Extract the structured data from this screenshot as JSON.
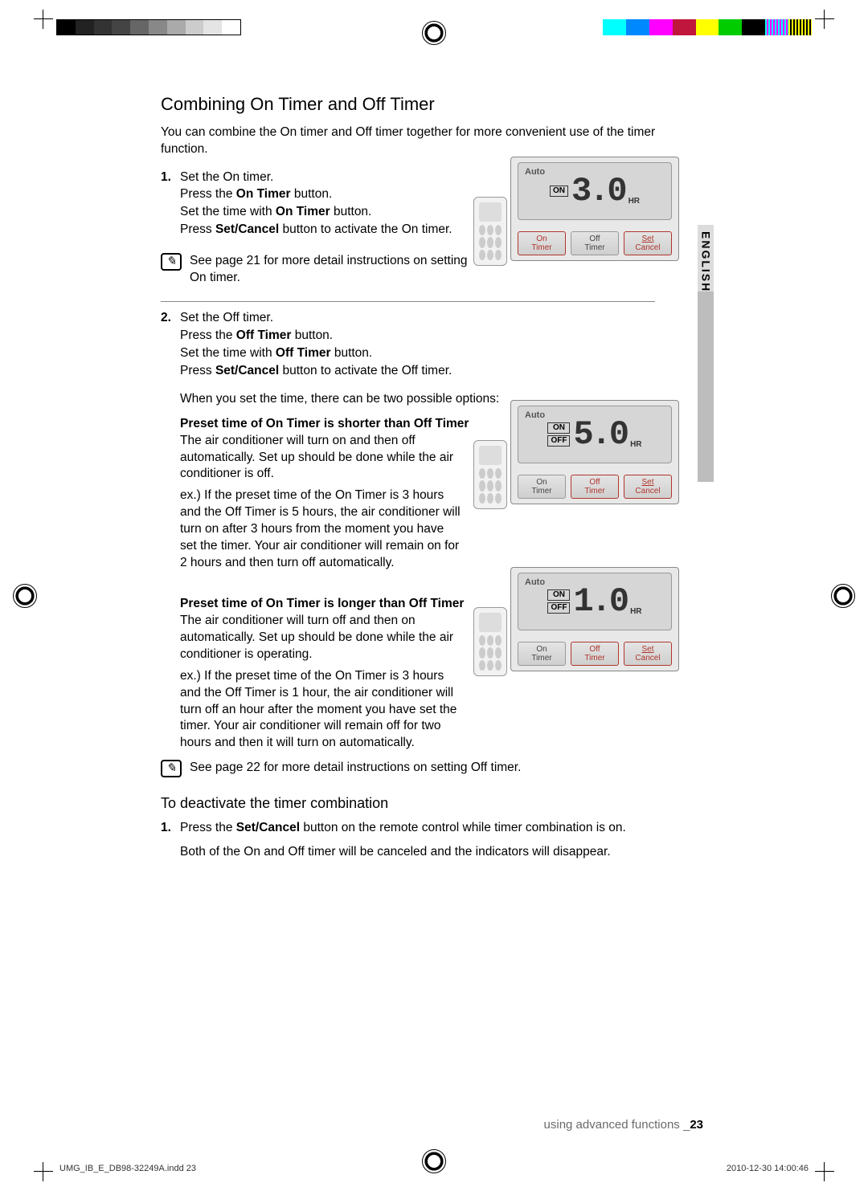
{
  "language_tab": "ENGLISH",
  "heading": "Combining On Timer and Off Timer",
  "intro": "You can combine the On timer and Off timer together for more convenient use of the timer function.",
  "step1": {
    "num": "1.",
    "title": "Set the On timer.",
    "l1a": "Press the ",
    "l1b": "On Timer",
    "l1c": " button.",
    "l2a": "Set the time with ",
    "l2b": "On Timer",
    "l2c": " button.",
    "l3a": "Press ",
    "l3b": "Set/Cancel",
    "l3c": " button to activate the On timer."
  },
  "note1": "See page 21 for more detail instructions on setting On timer.",
  "step2": {
    "num": "2.",
    "title": "Set the Off timer.",
    "l1a": "Press the ",
    "l1b": "Off Timer",
    "l1c": " button.",
    "l2a": "Set the time with ",
    "l2b": "Off Timer",
    "l2c": " button.",
    "l3a": "Press ",
    "l3b": "Set/Cancel",
    "l3c": " button to activate the Off timer."
  },
  "options_intro": "When you set the time, there can be two possible options:",
  "opt_short": {
    "title": "Preset time of On Timer is shorter than Off Timer",
    "p1": "The air conditioner will turn on and then off automatically. Set up should be done while the air conditioner is off.",
    "p2": "ex.) If the preset time of the On Timer is 3 hours and the Off Timer is 5 hours, the air conditioner will turn on after 3 hours from the moment you have set the timer. Your air conditioner will remain on for 2 hours and then turn off automatically."
  },
  "opt_long": {
    "title": "Preset time of On Timer is longer than Off Timer",
    "p1": "The air conditioner will turn off and then on automatically. Set up should be done while the air conditioner is operating.",
    "p2": "ex.) If the preset time of the On Timer is 3 hours and the Off Timer is 1 hour, the air conditioner will turn off an hour after the moment you have set the timer. Your air conditioner will remain off for two hours and then it will turn on automatically."
  },
  "note2": "See page 22 for more detail instructions on setting Off timer.",
  "deactivate": {
    "heading": "To deactivate the timer combination",
    "num": "1.",
    "l1a": "Press the ",
    "l1b": "Set/Cancel",
    "l1c": " button on the remote control while timer combination is on.",
    "l2": "Both of the On and Off timer will be canceled and the indicators will disappear."
  },
  "device_labels": {
    "auto": "Auto",
    "on": "ON",
    "off": "OFF",
    "hr": "HR",
    "on_timer": "On<br>Timer",
    "off_timer": "Off<br>Timer",
    "set_cancel": "Set<br>Cancel",
    "set_cancel_u": "Set",
    "cancel": "Cancel"
  },
  "device1_value": "3.0",
  "device2_value": "5.0",
  "device3_value": "1.0",
  "footer_text": "using advanced functions _",
  "footer_page": "23",
  "slug_left": "UMG_IB_E_DB98-32249A.indd   23",
  "slug_right": "2010-12-30   14:00:46"
}
